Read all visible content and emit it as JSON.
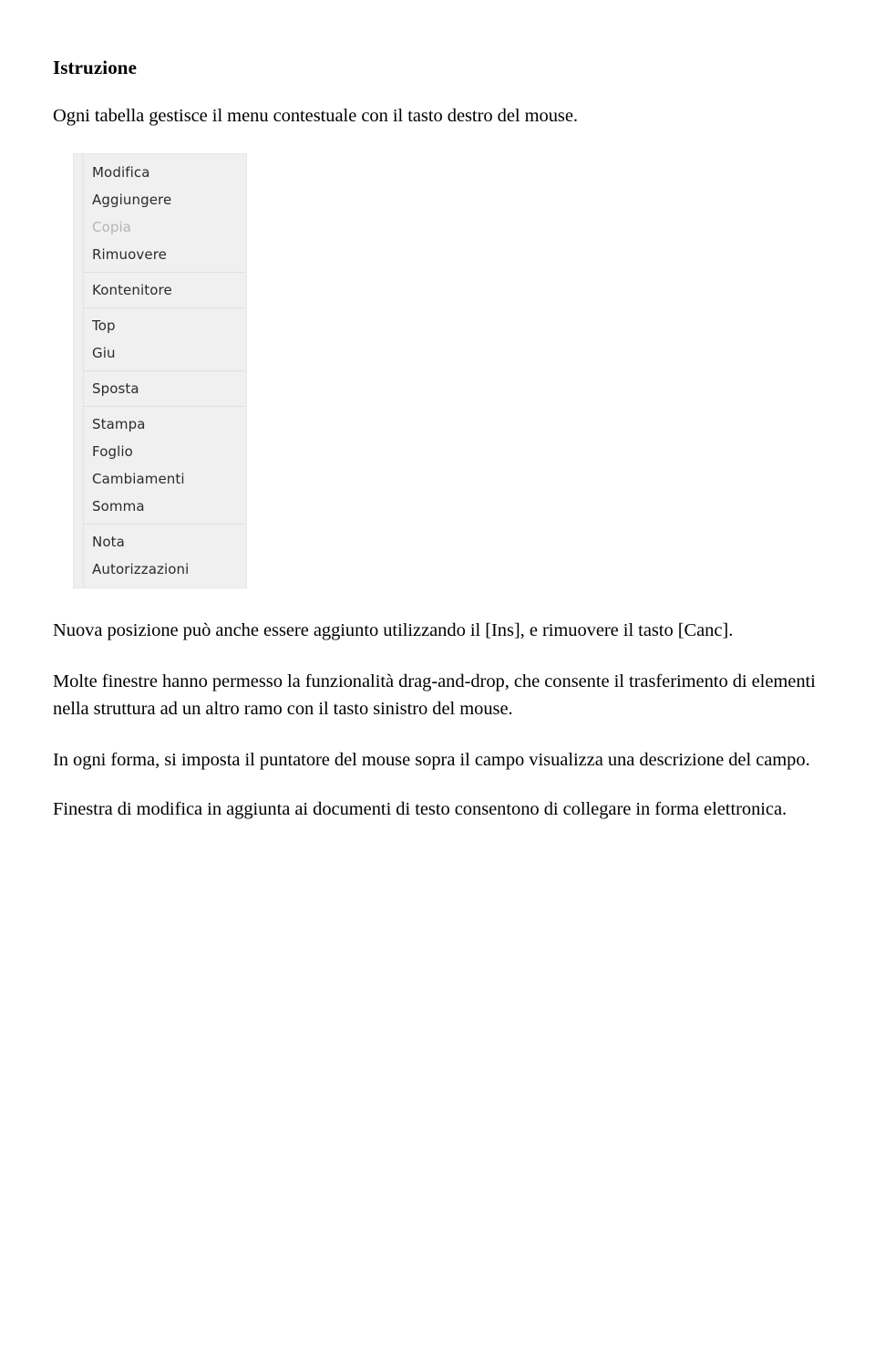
{
  "document": {
    "heading": "Istruzione",
    "intro": "Ogni tabella gestisce il menu contestuale con il tasto destro del mouse.",
    "paragraphs": {
      "p1": "Nuova posizione può anche essere aggiunto utilizzando il [Ins], e rimuovere il tasto [Canc].",
      "p2_line1": "Molte finestre hanno permesso la funzionalità drag-and-drop, che consente il trasferimento di elementi",
      "p2_line2": "nella struttura ad un altro ramo con il tasto sinistro del mouse.",
      "p3": "In ogni forma, si imposta il puntatore del mouse sopra il campo visualizza una descrizione del campo.",
      "p4": "Finestra di modifica in aggiunta ai documenti di testo consentono di collegare in forma elettronica."
    }
  },
  "context_menu": {
    "groups": [
      {
        "items": [
          {
            "label": "Modifica",
            "disabled": false
          },
          {
            "label": "Aggiungere",
            "disabled": false
          },
          {
            "label": "Copia",
            "disabled": true
          },
          {
            "label": "Rimuovere",
            "disabled": false
          }
        ]
      },
      {
        "items": [
          {
            "label": "Kontenitore",
            "disabled": false
          }
        ]
      },
      {
        "items": [
          {
            "label": "Top",
            "disabled": false
          },
          {
            "label": "Giu",
            "disabled": false
          }
        ]
      },
      {
        "items": [
          {
            "label": "Sposta",
            "disabled": false
          }
        ]
      },
      {
        "items": [
          {
            "label": "Stampa",
            "disabled": false
          },
          {
            "label": "Foglio",
            "disabled": false
          },
          {
            "label": "Cambiamenti",
            "disabled": false
          },
          {
            "label": "Somma",
            "disabled": false
          }
        ]
      },
      {
        "items": [
          {
            "label": "Nota",
            "disabled": false
          },
          {
            "label": "Autorizzazioni",
            "disabled": false
          }
        ]
      }
    ],
    "colors": {
      "background": "#f0f0f0",
      "gutter": "#efefef",
      "separator": "#e0e0e0",
      "text": "#2b2b2b",
      "text_disabled": "#b4b4b4"
    }
  }
}
